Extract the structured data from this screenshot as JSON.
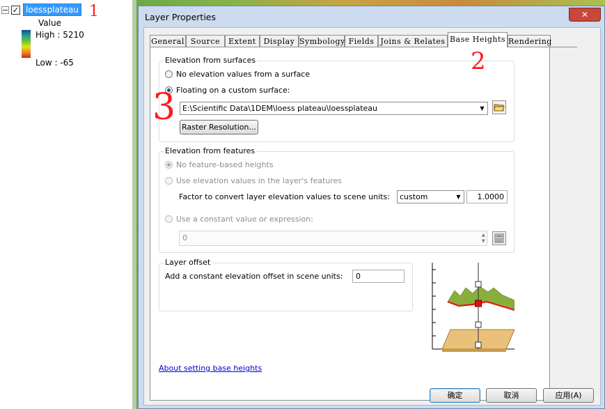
{
  "toc": {
    "layer_name": "loessplateau",
    "checked_mark": "✓",
    "value_label": "Value",
    "high_label": "High : 5210",
    "low_label": "Low : -65",
    "ramp_colors": [
      "#0f4a8a",
      "#64c43a",
      "#e4e21a",
      "#c42a1a"
    ]
  },
  "annotations": [
    "1",
    "2",
    "3"
  ],
  "dialog": {
    "title": "Layer Properties",
    "close_label": "✕",
    "tabs": [
      "General",
      "Source",
      "Extent",
      "Display",
      "Symbology",
      "Fields",
      "Joins & Relates",
      "Base Heights",
      "Rendering"
    ],
    "active_tab": "Base Heights",
    "surfaces": {
      "group_title": "Elevation from surfaces",
      "no_surface_label": "No elevation values from a surface",
      "floating_label": "Floating on a custom surface:",
      "surface_path": "E:\\Scientific Data\\1DEM\\loess plateau\\loessplateau",
      "raster_resolution_label": "Raster Resolution..."
    },
    "features": {
      "group_title": "Elevation from features",
      "no_feature_label": "No feature-based heights",
      "use_values_label": "Use elevation values in the layer's features",
      "factor_label": "Factor to convert layer elevation values to scene units:",
      "unit_option": "custom",
      "factor_value": "1.0000",
      "constant_label": "Use a constant value or expression:",
      "constant_value": "0"
    },
    "offset": {
      "group_title": "Layer offset",
      "offset_label": "Add a constant elevation offset in scene units:",
      "offset_value": "0"
    },
    "help_link": "About setting base heights",
    "buttons": {
      "ok": "确定",
      "cancel": "取消",
      "apply": "应用(A)"
    },
    "accent_color": "#3399ff"
  }
}
